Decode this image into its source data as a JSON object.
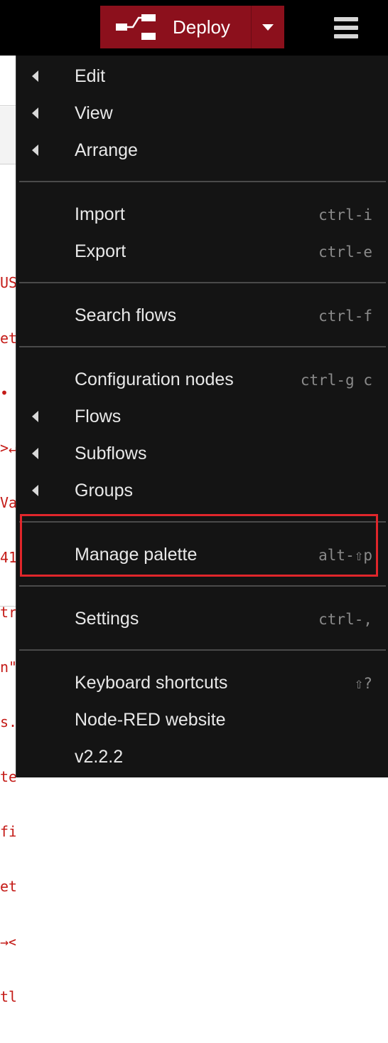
{
  "header": {
    "deploy_label": "Deploy",
    "accent_color": "#8c101c"
  },
  "workspace": {
    "code_lines": [
      "US",
      "et",
      "•",
      ">↵",
      "Va",
      "41",
      "tr",
      "n\"",
      "s.",
      "te",
      "fi",
      "et",
      "→<",
      "tl"
    ]
  },
  "menu": {
    "edit": {
      "label": "Edit"
    },
    "view": {
      "label": "View"
    },
    "arrange": {
      "label": "Arrange"
    },
    "import": {
      "label": "Import",
      "shortcut": "ctrl-i"
    },
    "export": {
      "label": "Export",
      "shortcut": "ctrl-e"
    },
    "search_flows": {
      "label": "Search flows",
      "shortcut": "ctrl-f"
    },
    "configuration_nodes": {
      "label": "Configuration nodes",
      "shortcut": "ctrl-g c"
    },
    "flows": {
      "label": "Flows"
    },
    "subflows": {
      "label": "Subflows"
    },
    "groups": {
      "label": "Groups"
    },
    "manage_palette": {
      "label": "Manage palette",
      "shortcut": "alt-⇧p"
    },
    "settings": {
      "label": "Settings",
      "shortcut": "ctrl-,"
    },
    "keyboard_shortcuts": {
      "label": "Keyboard shortcuts",
      "shortcut": "⇧?"
    },
    "node_red_website": {
      "label": "Node-RED website"
    },
    "version": {
      "label": "v2.2.2"
    }
  }
}
